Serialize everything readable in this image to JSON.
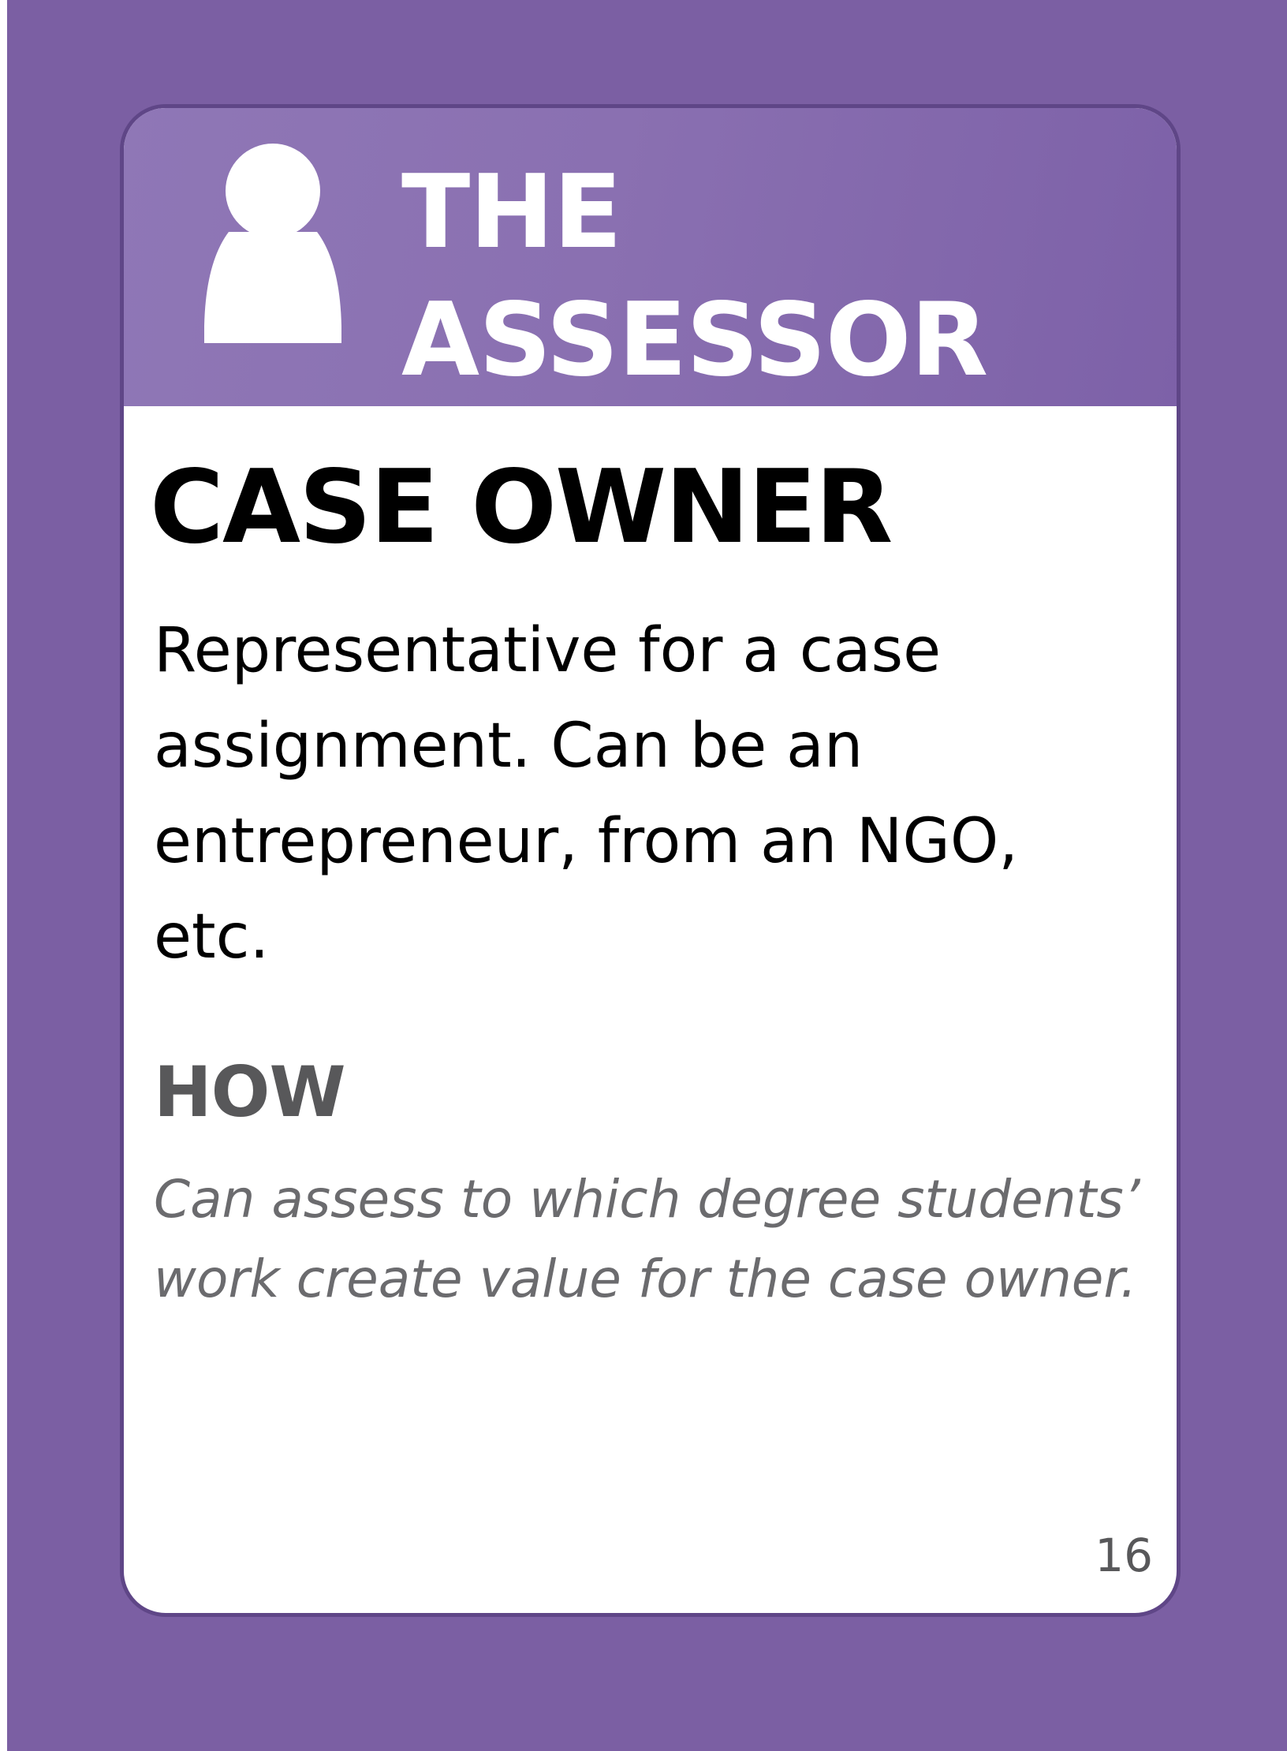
{
  "card": {
    "category": {
      "line1": "THE",
      "line2": "ASSESSOR",
      "icon": "person-icon",
      "color": "#8a70b1"
    },
    "role_title": "CASE OWNER",
    "description": "Representative for a case assignment. Can be an entrepreneur, from an NGO, etc.",
    "how_heading": "HOW",
    "how_text": "Can assess to which degree students’ work create value for the case owner.",
    "number": "16"
  },
  "colors": {
    "background": "#7b5fa3",
    "card_border": "#5f4687",
    "header": "#8a70b1",
    "how_text": "#6b6b6e"
  }
}
